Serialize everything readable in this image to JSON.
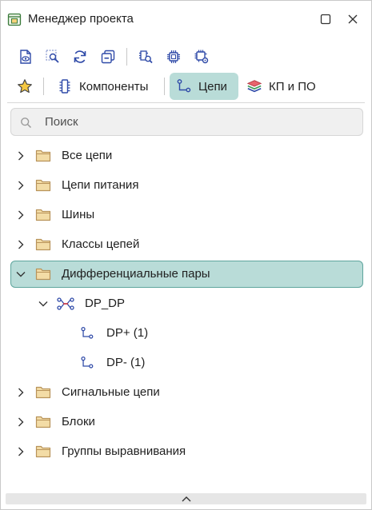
{
  "window": {
    "title": "Менеджер проекта",
    "icons": {
      "app": "project-manager-icon",
      "maximize": "maximize-icon",
      "close": "close-icon"
    }
  },
  "toolbar": {
    "buttons": [
      "document-view-icon",
      "zoom-select-icon",
      "refresh-icon",
      "collapse-icon",
      "component-search-icon",
      "chip-icon",
      "chip-settings-icon"
    ]
  },
  "tabs": [
    {
      "label": "",
      "icon": "star-icon",
      "active": false
    },
    {
      "label": "Компоненты",
      "icon": "component-icon",
      "active": false
    },
    {
      "label": "Цепи",
      "icon": "net-icon",
      "active": true
    },
    {
      "label": "КП и ПО",
      "icon": "layers-icon",
      "active": false
    }
  ],
  "search": {
    "placeholder": "Поиск",
    "value": ""
  },
  "tree": {
    "items": [
      {
        "label": "Все цепи",
        "type": "folder",
        "expanded": false
      },
      {
        "label": "Цепи питания",
        "type": "folder",
        "expanded": false
      },
      {
        "label": "Шины",
        "type": "folder",
        "expanded": false
      },
      {
        "label": "Классы цепей",
        "type": "folder",
        "expanded": false
      },
      {
        "label": "Дифференциальные пары",
        "type": "folder",
        "expanded": true,
        "selected": true
      },
      {
        "label": "DP_DP",
        "type": "diff-pair",
        "expanded": true
      },
      {
        "label": "DP+ (1)",
        "type": "net"
      },
      {
        "label": "DP- (1)",
        "type": "net"
      },
      {
        "label": "Сигнальные цепи",
        "type": "folder",
        "expanded": false
      },
      {
        "label": "Блоки",
        "type": "folder",
        "expanded": false
      },
      {
        "label": "Группы выравнивания",
        "type": "folder",
        "expanded": false
      }
    ]
  },
  "colors": {
    "accent": "#b9dcd8",
    "accent_border": "#5ea59d",
    "folder": "#f3dca6",
    "folder_stroke": "#b8935a",
    "icon_blue": "#2f4aa8"
  }
}
